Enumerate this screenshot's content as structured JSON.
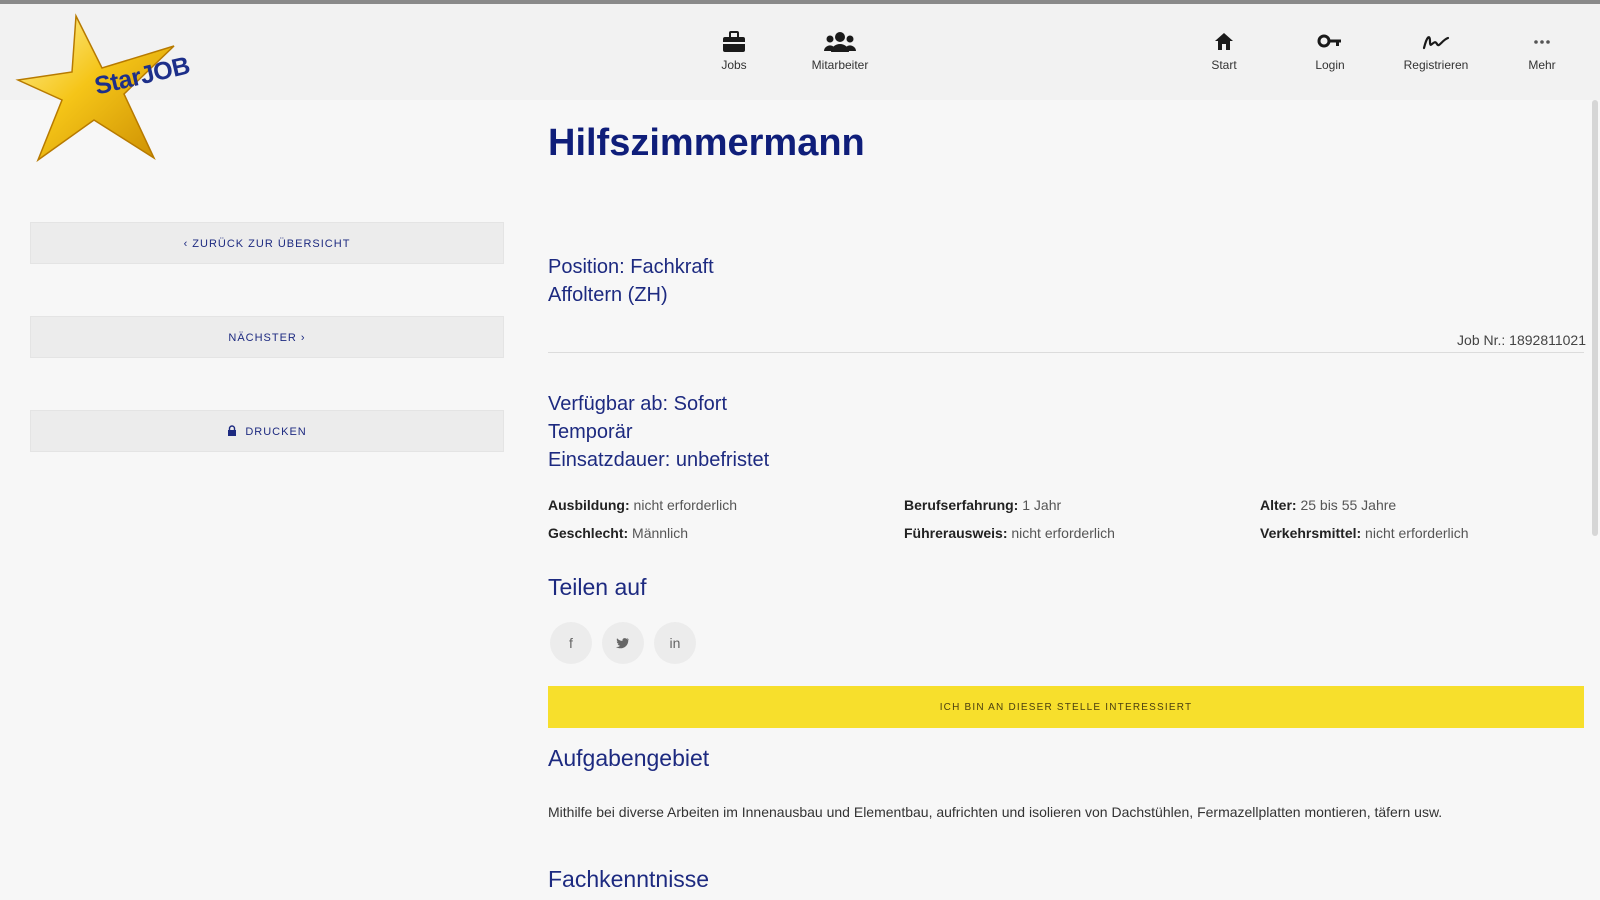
{
  "brand": {
    "logo_text": "StarJOB",
    "star_color": "#f5c518",
    "star_shadow": "#c98a00"
  },
  "nav": {
    "center": [
      {
        "label": "Jobs",
        "icon": "briefcase-icon"
      },
      {
        "label": "Mitarbeiter",
        "icon": "users-icon"
      }
    ],
    "right": [
      {
        "label": "Start",
        "icon": "home-icon"
      },
      {
        "label": "Login",
        "icon": "key-icon"
      },
      {
        "label": "Registrieren",
        "icon": "signature-icon"
      },
      {
        "label": "Mehr",
        "icon": "more-icon"
      }
    ]
  },
  "sidebar": {
    "back_label": "‹ Zurück zur Übersicht",
    "next_label": "Nächster ›",
    "print_label": "Drucken",
    "print_icon": "lock-icon"
  },
  "job": {
    "title": "Hilfszimmermann",
    "position": "Position: Fachkraft",
    "location": "Affoltern (ZH)",
    "job_nr": "Job Nr.: 1892811021",
    "available": "Verfügbar ab: Sofort",
    "type": "Temporär",
    "duration": "Einsatzdauer: unbefristet",
    "properties": [
      {
        "label": "Ausbildung:",
        "value": " nicht erforderlich"
      },
      {
        "label": "Berufserfahrung:",
        "value": " 1 Jahr"
      },
      {
        "label": "Alter:",
        "value": " 25 bis 55 Jahre"
      },
      {
        "label": "Geschlecht:",
        "value": " Männlich"
      },
      {
        "label": "Führerausweis:",
        "value": " nicht erforderlich"
      },
      {
        "label": "Verkehrsmittel:",
        "value": " nicht erforderlich"
      }
    ]
  },
  "share": {
    "title": "Teilen auf",
    "networks": [
      {
        "glyph": "f",
        "icon": "facebook-icon"
      },
      {
        "glyph": "🐦",
        "icon": "twitter-icon"
      },
      {
        "glyph": "in",
        "icon": "linkedin-icon"
      }
    ]
  },
  "cta": {
    "label": "Ich bin an dieser Stelle interessiert",
    "color": "#f7df2c"
  },
  "tasks": {
    "title": "Aufgabengebiet",
    "text": "Mithilfe bei diverse Arbeiten im Innenausbau und Elementbau, aufrichten und isolieren von Dachstühlen, Fermazellplatten montieren, täfern usw."
  },
  "skills": {
    "title": "Fachkenntnisse"
  },
  "colors": {
    "accent_blue": "#1d2a80",
    "title_blue": "#0f1e7a"
  }
}
